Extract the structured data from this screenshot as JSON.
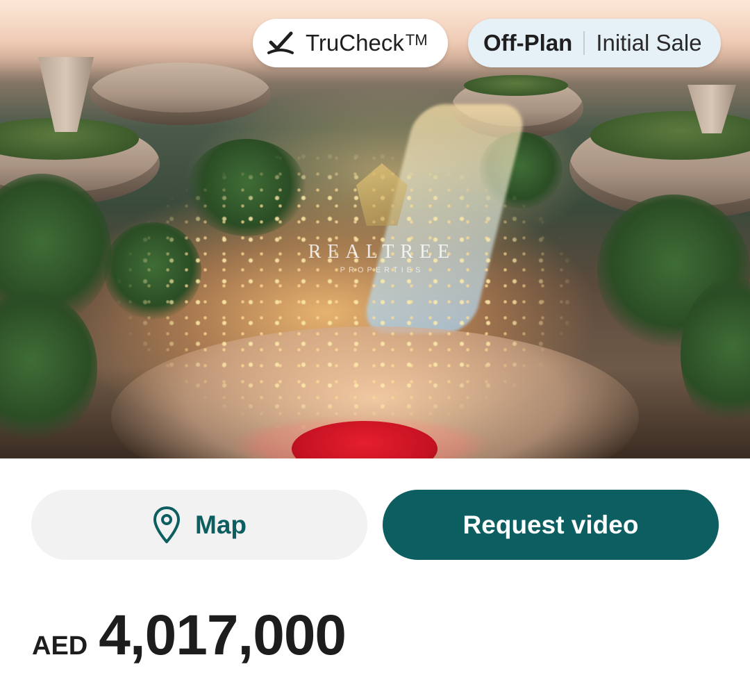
{
  "hero": {
    "image": "aerial-evening-market-plaza",
    "watermark": {
      "title": "REALTREE",
      "subtitle": "PROPERTIES"
    }
  },
  "badges": {
    "trucheck": {
      "label": "TruCheck",
      "trademark": "TM",
      "icon": "verified-check-icon"
    },
    "status": {
      "primary": "Off-Plan",
      "secondary": "Initial Sale"
    }
  },
  "actions": {
    "map": {
      "label": "Map",
      "icon": "location-pin-icon"
    },
    "request_video": {
      "label": "Request video"
    }
  },
  "price": {
    "currency": "AED",
    "amount": "4,017,000"
  },
  "colors": {
    "brand": "#0d5e60",
    "status_pill_bg": "#e6f1f7",
    "map_button_bg": "#f2f2f2"
  }
}
